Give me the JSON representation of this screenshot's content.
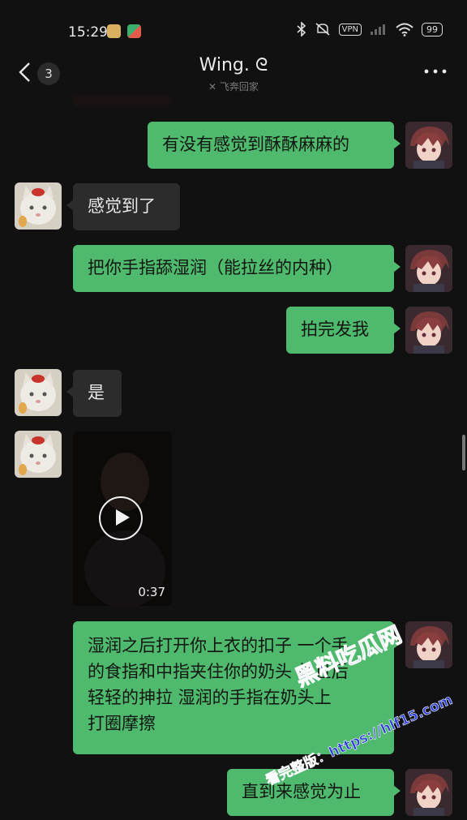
{
  "status_bar": {
    "time": "15:29",
    "vpn_label": "VPN",
    "battery": "99"
  },
  "header": {
    "unread_count": "3",
    "title": "Wing. ᘓ",
    "subtitle": "飞奔回家"
  },
  "messages": [
    {
      "sender": "me",
      "type": "text",
      "text": "有没有感觉到酥酥麻麻的"
    },
    {
      "sender": "them",
      "type": "text",
      "text": "感觉到了"
    },
    {
      "sender": "me",
      "type": "text",
      "text": "把你手指舔湿润（能拉丝的内种）"
    },
    {
      "sender": "me",
      "type": "text",
      "text": "拍完发我"
    },
    {
      "sender": "them",
      "type": "text",
      "text": "是"
    },
    {
      "sender": "them",
      "type": "video",
      "duration": "0:37"
    },
    {
      "sender": "me",
      "type": "text",
      "lines": [
        "湿润之后打开你上衣的扣子 一个手",
        "的食指和中指夹住你的奶头 并且后",
        "轻轻的抻拉 湿润的手指在奶头上",
        "打圈摩擦"
      ]
    },
    {
      "sender": "me",
      "type": "text",
      "text": "直到来感觉为止"
    }
  ],
  "watermark": {
    "line1": "黑料吃瓜网",
    "line2": "看完整版：https://hlf15.com"
  },
  "colors": {
    "background": "#111111",
    "my_bubble": "#4fba6d",
    "their_bubble": "#2c2c2c",
    "watermark": "#2c3fd8"
  },
  "icons": [
    "bluetooth-icon",
    "mute-icon",
    "signal-icon",
    "wifi-icon",
    "back-chevron-icon",
    "more-icon",
    "play-icon",
    "status-app-icon"
  ]
}
